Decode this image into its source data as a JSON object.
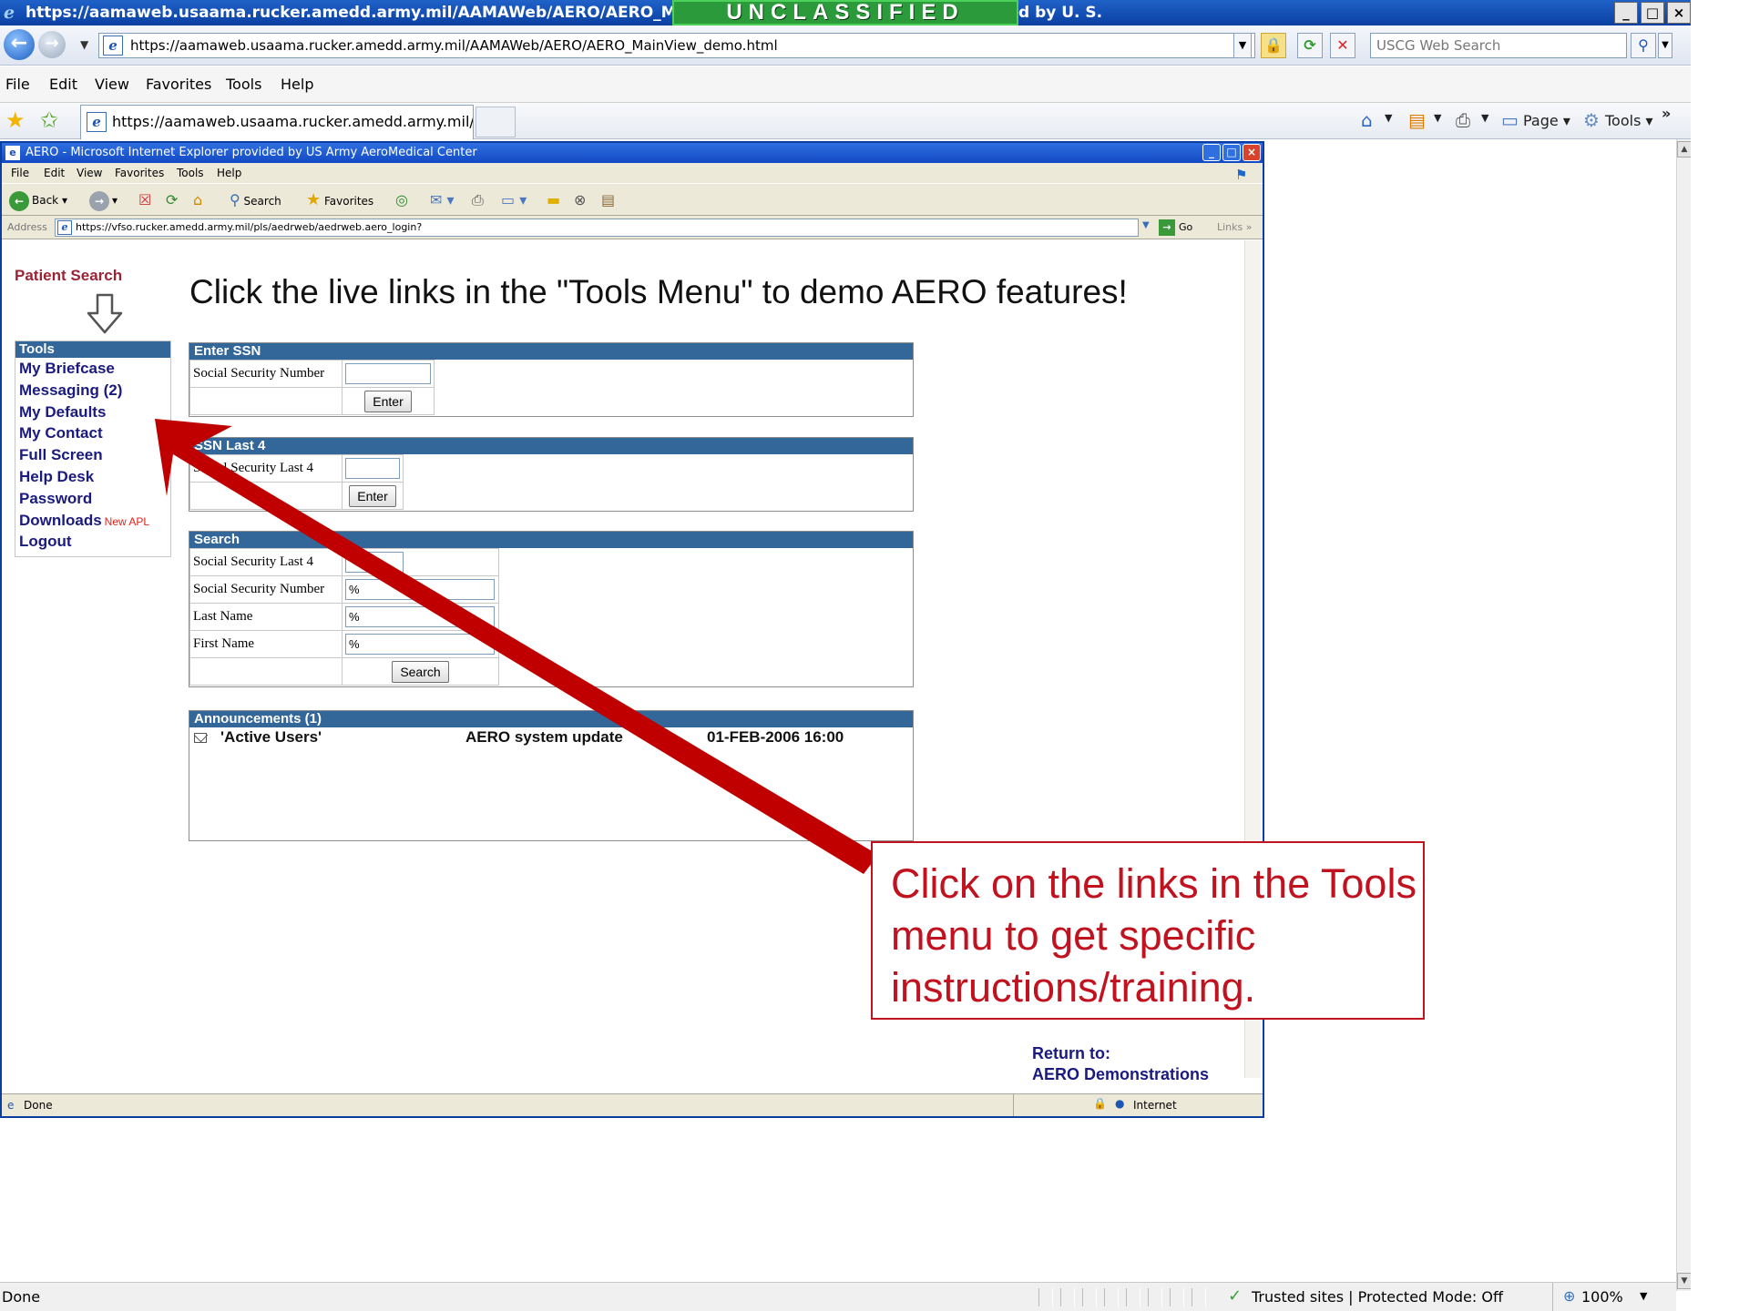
{
  "outer_browser": {
    "title": "https://aamaweb.usaama.rucker.amedd.army.mil/AAMAWeb/AERO/AERO_MainView_",
    "title_suffix": "d by U. S.",
    "classification_banner": "UNCLASSIFIED",
    "window_buttons": [
      "_",
      "□",
      "×"
    ],
    "url": "https://aamaweb.usaama.rucker.amedd.army.mil/AAMAWeb/AERO/AERO_MainView_demo.html",
    "search_placeholder": "USCG Web Search",
    "menu": [
      "File",
      "Edit",
      "View",
      "Favorites",
      "Tools",
      "Help"
    ],
    "tab_title": "https://aamaweb.usaama.rucker.amedd.army.mil/AA...",
    "command_bar": {
      "page": "Page",
      "tools": "Tools"
    },
    "status_text": "Done",
    "zone": "Trusted sites | Protected Mode: Off",
    "zoom": "100%"
  },
  "inner_browser": {
    "title": "AERO - Microsoft Internet Explorer provided by US Army AeroMedical Center",
    "menu": [
      "File",
      "Edit",
      "View",
      "Favorites",
      "Tools",
      "Help"
    ],
    "toolbar": {
      "back": "Back",
      "search": "Search",
      "favorites": "Favorites"
    },
    "address_label": "Address",
    "address": "https://vfso.rucker.amedd.army.mil/pls/aedrweb/aedrweb.aero_login?",
    "go": "Go",
    "links": "Links",
    "status_left": "Done",
    "status_zone": "Internet"
  },
  "page": {
    "patient_search": "Patient Search",
    "headline": "Click the live links in the \"Tools Menu\" to demo AERO features!",
    "tools": {
      "header": "Tools",
      "items": [
        "My Briefcase",
        "Messaging (2)",
        "My Defaults",
        "My Contact",
        "Full Screen",
        "Help Desk",
        "Password",
        "Downloads",
        "Logout"
      ],
      "downloads_badge": "New APL"
    },
    "enter_ssn": {
      "header": "Enter SSN",
      "label": "Social Security Number",
      "value": "",
      "button": "Enter"
    },
    "ssn_last4": {
      "header": "SSN Last 4",
      "label": "Social Security Last 4",
      "value": "",
      "button": "Enter"
    },
    "search": {
      "header": "Search",
      "rows": [
        {
          "label": "Social Security Last 4",
          "value": ""
        },
        {
          "label": "Social Security Number",
          "value": "%"
        },
        {
          "label": "Last Name",
          "value": "%"
        },
        {
          "label": "First Name",
          "value": "%"
        }
      ],
      "button": "Search"
    },
    "announcements": {
      "header": "Announcements (1)",
      "items": [
        {
          "group": "'Active Users'",
          "subject": "AERO system update",
          "date": "01-FEB-2006 16:00"
        }
      ]
    },
    "return_to": {
      "label": "Return to:",
      "link": "AERO Demonstrations"
    }
  },
  "overlay": {
    "callout_text": "Click on the links in the Tools menu to get specific instructions/training.",
    "arrow_color": "#c00000"
  }
}
